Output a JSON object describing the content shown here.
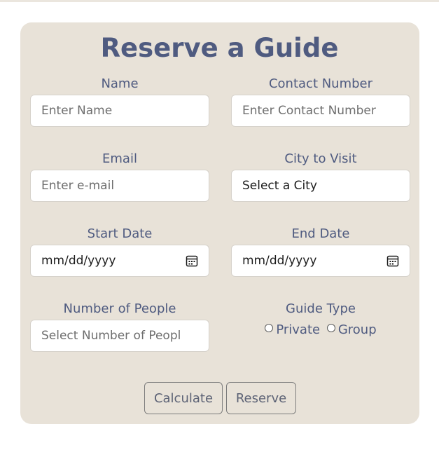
{
  "form": {
    "title": "Reserve a Guide",
    "name": {
      "label": "Name",
      "placeholder": "Enter Name"
    },
    "contact": {
      "label": "Contact Number",
      "placeholder": "Enter Contact Number"
    },
    "email": {
      "label": "Email",
      "placeholder": "Enter e-mail"
    },
    "city": {
      "label": "City to Visit",
      "value": "Select a City"
    },
    "start_date": {
      "label": "Start Date",
      "value": "mm/dd/yyyy",
      "icon": "calendar-icon"
    },
    "end_date": {
      "label": "End Date",
      "value": "mm/dd/yyyy",
      "icon": "calendar-icon"
    },
    "people": {
      "label": "Number of People",
      "placeholder": "Select Number of Peopl"
    },
    "guide_type": {
      "label": "Guide Type",
      "options": [
        "Private",
        "Group"
      ]
    },
    "buttons": {
      "calculate": "Calculate",
      "reserve": "Reserve"
    }
  },
  "colors": {
    "card_background": "#e8e2d8",
    "accent_text": "#4f5b80"
  }
}
